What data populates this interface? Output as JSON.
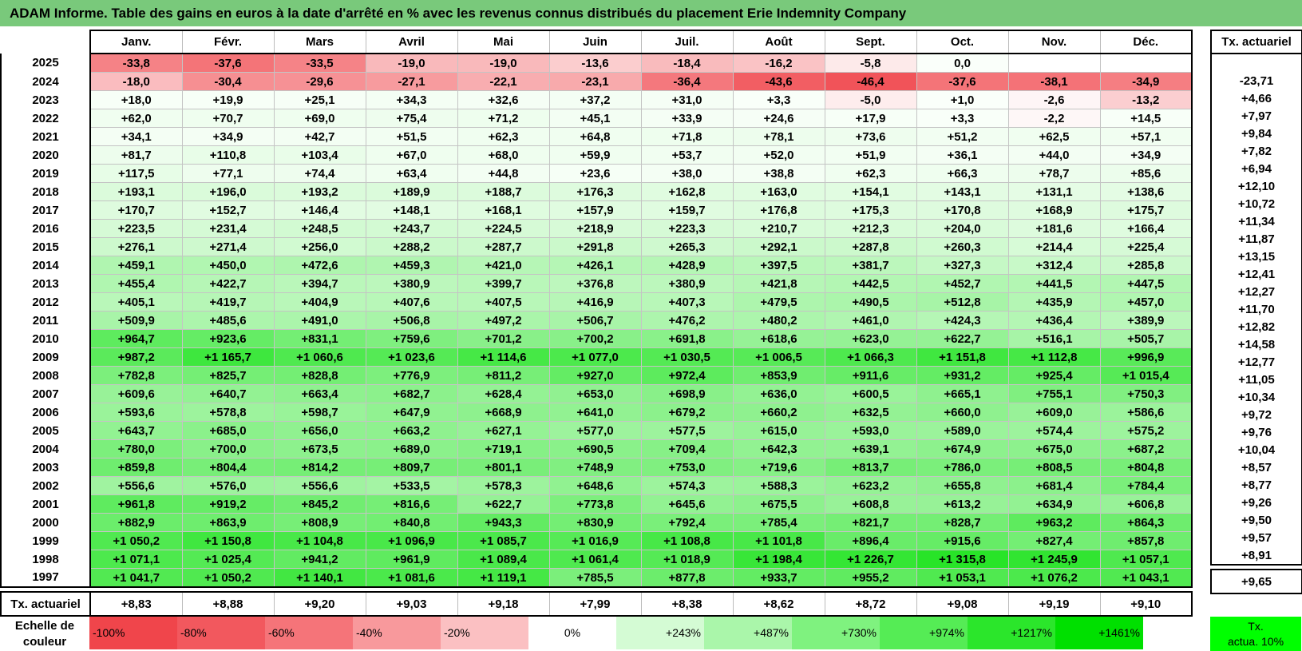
{
  "title": "ADAM Informe. Table des gains en euros à la date d'arrêté en % avec les revenus connus distribués du placement Erie Indemnity Company",
  "months": [
    "Janv.",
    "Févr.",
    "Mars",
    "Avril",
    "Mai",
    "Juin",
    "Juil.",
    "Août",
    "Sept.",
    "Oct.",
    "Nov.",
    "Déc."
  ],
  "side_header": "Tx. actuariel",
  "rows": [
    {
      "year": "2025",
      "values": [
        "-33,8",
        "-37,6",
        "-33,5",
        "-19,0",
        "-19,0",
        "-13,6",
        "-18,4",
        "-16,2",
        "-5,8",
        "0,0",
        "",
        ""
      ],
      "tx": ""
    },
    {
      "year": "2024",
      "values": [
        "-18,0",
        "-30,4",
        "-29,6",
        "-27,1",
        "-22,1",
        "-23,1",
        "-36,4",
        "-43,6",
        "-46,4",
        "-37,6",
        "-38,1",
        "-34,9"
      ],
      "tx": "-23,71"
    },
    {
      "year": "2023",
      "values": [
        "+18,0",
        "+19,9",
        "+25,1",
        "+34,3",
        "+32,6",
        "+37,2",
        "+31,0",
        "+3,3",
        "-5,0",
        "+1,0",
        "-2,6",
        "-13,2"
      ],
      "tx": "+4,66"
    },
    {
      "year": "2022",
      "values": [
        "+62,0",
        "+70,7",
        "+69,0",
        "+75,4",
        "+71,2",
        "+45,1",
        "+33,9",
        "+24,6",
        "+17,9",
        "+3,3",
        "-2,2",
        "+14,5"
      ],
      "tx": "+7,97"
    },
    {
      "year": "2021",
      "values": [
        "+34,1",
        "+34,9",
        "+42,7",
        "+51,5",
        "+62,3",
        "+64,8",
        "+71,8",
        "+78,1",
        "+73,6",
        "+51,2",
        "+62,5",
        "+57,1"
      ],
      "tx": "+9,84"
    },
    {
      "year": "2020",
      "values": [
        "+81,7",
        "+110,8",
        "+103,4",
        "+67,0",
        "+68,0",
        "+59,9",
        "+53,7",
        "+52,0",
        "+51,9",
        "+36,1",
        "+44,0",
        "+34,9"
      ],
      "tx": "+7,82"
    },
    {
      "year": "2019",
      "values": [
        "+117,5",
        "+77,1",
        "+74,4",
        "+63,4",
        "+44,8",
        "+23,6",
        "+38,0",
        "+38,8",
        "+62,3",
        "+66,3",
        "+78,7",
        "+85,6"
      ],
      "tx": "+6,94"
    },
    {
      "year": "2018",
      "values": [
        "+193,1",
        "+196,0",
        "+193,2",
        "+189,9",
        "+188,7",
        "+176,3",
        "+162,8",
        "+163,0",
        "+154,1",
        "+143,1",
        "+131,1",
        "+138,6"
      ],
      "tx": "+12,10"
    },
    {
      "year": "2017",
      "values": [
        "+170,7",
        "+152,7",
        "+146,4",
        "+148,1",
        "+168,1",
        "+157,9",
        "+159,7",
        "+176,8",
        "+175,3",
        "+170,8",
        "+168,9",
        "+175,7"
      ],
      "tx": "+10,72"
    },
    {
      "year": "2016",
      "values": [
        "+223,5",
        "+231,4",
        "+248,5",
        "+243,7",
        "+224,5",
        "+218,9",
        "+223,3",
        "+210,7",
        "+212,3",
        "+204,0",
        "+181,6",
        "+166,4"
      ],
      "tx": "+11,34"
    },
    {
      "year": "2015",
      "values": [
        "+276,1",
        "+271,4",
        "+256,0",
        "+288,2",
        "+287,7",
        "+291,8",
        "+265,3",
        "+292,1",
        "+287,8",
        "+260,3",
        "+214,4",
        "+225,4"
      ],
      "tx": "+11,87"
    },
    {
      "year": "2014",
      "values": [
        "+459,1",
        "+450,0",
        "+472,6",
        "+459,3",
        "+421,0",
        "+426,1",
        "+428,9",
        "+397,5",
        "+381,7",
        "+327,3",
        "+312,4",
        "+285,8"
      ],
      "tx": "+13,15"
    },
    {
      "year": "2013",
      "values": [
        "+455,4",
        "+422,7",
        "+394,7",
        "+380,9",
        "+399,7",
        "+376,8",
        "+380,9",
        "+421,8",
        "+442,5",
        "+452,7",
        "+441,5",
        "+447,5"
      ],
      "tx": "+12,41"
    },
    {
      "year": "2012",
      "values": [
        "+405,1",
        "+419,7",
        "+404,9",
        "+407,6",
        "+407,5",
        "+416,9",
        "+407,3",
        "+479,5",
        "+490,5",
        "+512,8",
        "+435,9",
        "+457,0"
      ],
      "tx": "+12,27"
    },
    {
      "year": "2011",
      "values": [
        "+509,9",
        "+485,6",
        "+491,0",
        "+506,8",
        "+497,2",
        "+506,7",
        "+476,2",
        "+480,2",
        "+461,0",
        "+424,3",
        "+436,4",
        "+389,9"
      ],
      "tx": "+11,70"
    },
    {
      "year": "2010",
      "values": [
        "+964,7",
        "+923,6",
        "+831,1",
        "+759,6",
        "+701,2",
        "+700,2",
        "+691,8",
        "+618,6",
        "+623,0",
        "+622,7",
        "+516,1",
        "+505,7"
      ],
      "tx": "+12,82"
    },
    {
      "year": "2009",
      "values": [
        "+987,2",
        "+1 165,7",
        "+1 060,6",
        "+1 023,6",
        "+1 114,6",
        "+1 077,0",
        "+1 030,5",
        "+1 006,5",
        "+1 066,3",
        "+1 151,8",
        "+1 112,8",
        "+996,9"
      ],
      "tx": "+14,58"
    },
    {
      "year": "2008",
      "values": [
        "+782,8",
        "+825,7",
        "+828,8",
        "+776,9",
        "+811,2",
        "+927,0",
        "+972,4",
        "+853,9",
        "+911,6",
        "+931,2",
        "+925,4",
        "+1 015,4"
      ],
      "tx": "+12,77"
    },
    {
      "year": "2007",
      "values": [
        "+609,6",
        "+640,7",
        "+663,4",
        "+682,7",
        "+628,4",
        "+653,0",
        "+698,9",
        "+636,0",
        "+600,5",
        "+665,1",
        "+755,1",
        "+750,3"
      ],
      "tx": "+11,05"
    },
    {
      "year": "2006",
      "values": [
        "+593,6",
        "+578,8",
        "+598,7",
        "+647,9",
        "+668,9",
        "+641,0",
        "+679,2",
        "+660,2",
        "+632,5",
        "+660,0",
        "+609,0",
        "+586,6"
      ],
      "tx": "+10,34"
    },
    {
      "year": "2005",
      "values": [
        "+643,7",
        "+685,0",
        "+656,0",
        "+663,2",
        "+627,1",
        "+577,0",
        "+577,5",
        "+615,0",
        "+593,0",
        "+589,0",
        "+574,4",
        "+575,2"
      ],
      "tx": "+9,72"
    },
    {
      "year": "2004",
      "values": [
        "+780,0",
        "+700,0",
        "+673,5",
        "+689,0",
        "+719,1",
        "+690,5",
        "+709,4",
        "+642,3",
        "+639,1",
        "+674,9",
        "+675,0",
        "+687,2"
      ],
      "tx": "+9,76"
    },
    {
      "year": "2003",
      "values": [
        "+859,8",
        "+804,4",
        "+814,2",
        "+809,7",
        "+801,1",
        "+748,9",
        "+753,0",
        "+719,6",
        "+813,7",
        "+786,0",
        "+808,5",
        "+804,8"
      ],
      "tx": "+10,04"
    },
    {
      "year": "2002",
      "values": [
        "+556,6",
        "+576,0",
        "+556,6",
        "+533,5",
        "+578,3",
        "+648,6",
        "+574,3",
        "+588,3",
        "+623,2",
        "+655,8",
        "+681,4",
        "+784,4"
      ],
      "tx": "+8,57"
    },
    {
      "year": "2001",
      "values": [
        "+961,8",
        "+919,2",
        "+845,2",
        "+816,6",
        "+622,7",
        "+773,8",
        "+645,6",
        "+675,5",
        "+608,8",
        "+613,2",
        "+634,9",
        "+606,8"
      ],
      "tx": "+8,77"
    },
    {
      "year": "2000",
      "values": [
        "+882,9",
        "+863,9",
        "+808,9",
        "+840,8",
        "+943,3",
        "+830,9",
        "+792,4",
        "+785,4",
        "+821,7",
        "+828,7",
        "+963,2",
        "+864,3"
      ],
      "tx": "+9,26"
    },
    {
      "year": "1999",
      "values": [
        "+1 050,2",
        "+1 150,8",
        "+1 104,8",
        "+1 096,9",
        "+1 085,7",
        "+1 016,9",
        "+1 108,8",
        "+1 101,8",
        "+896,4",
        "+915,6",
        "+827,4",
        "+857,8"
      ],
      "tx": "+9,50"
    },
    {
      "year": "1998",
      "values": [
        "+1 071,1",
        "+1 025,4",
        "+941,2",
        "+961,9",
        "+1 089,4",
        "+1 061,4",
        "+1 018,9",
        "+1 198,4",
        "+1 226,7",
        "+1 315,8",
        "+1 245,9",
        "+1 057,1"
      ],
      "tx": "+9,57"
    },
    {
      "year": "1997",
      "values": [
        "+1 041,7",
        "+1 050,2",
        "+1 140,1",
        "+1 081,6",
        "+1 119,1",
        "+785,5",
        "+877,8",
        "+933,7",
        "+955,2",
        "+1 053,1",
        "+1 076,2",
        "+1 043,1"
      ],
      "tx": "+8,91"
    }
  ],
  "footer": {
    "label": "Tx. actuariel",
    "values": [
      "+8,83",
      "+8,88",
      "+9,20",
      "+9,03",
      "+9,18",
      "+7,99",
      "+8,38",
      "+8,62",
      "+8,72",
      "+9,08",
      "+9,19",
      "+9,10"
    ],
    "tx": "+9,65"
  },
  "scale": {
    "label_line1": "Echelle de",
    "label_line2": "couleur",
    "steps": [
      {
        "label": "-100%",
        "color": "#f0454b",
        "kind": "neg"
      },
      {
        "label": "-80%",
        "color": "#f2585e",
        "kind": "neg"
      },
      {
        "label": "-60%",
        "color": "#f57479",
        "kind": "neg"
      },
      {
        "label": "-40%",
        "color": "#f8999c",
        "kind": "neg"
      },
      {
        "label": "-20%",
        "color": "#fbc0c2",
        "kind": "neg"
      },
      {
        "label": "0%",
        "color": "#ffffff",
        "kind": "zero"
      },
      {
        "label": "+243%",
        "color": "#d4fbd4",
        "kind": "pos"
      },
      {
        "label": "+487%",
        "color": "#aaf6aa",
        "kind": "pos"
      },
      {
        "label": "+730%",
        "color": "#7ff27f",
        "kind": "pos"
      },
      {
        "label": "+974%",
        "color": "#55ec55",
        "kind": "pos"
      },
      {
        "label": "+1217%",
        "color": "#2be62b",
        "kind": "pos"
      },
      {
        "label": "+1461%",
        "color": "#00e000",
        "kind": "pos"
      }
    ],
    "tx_line1": "Tx.",
    "tx_line2": "actua. 10%",
    "tx_color": "#00ff00"
  },
  "colors": {
    "title_bg": "#79c97b"
  }
}
